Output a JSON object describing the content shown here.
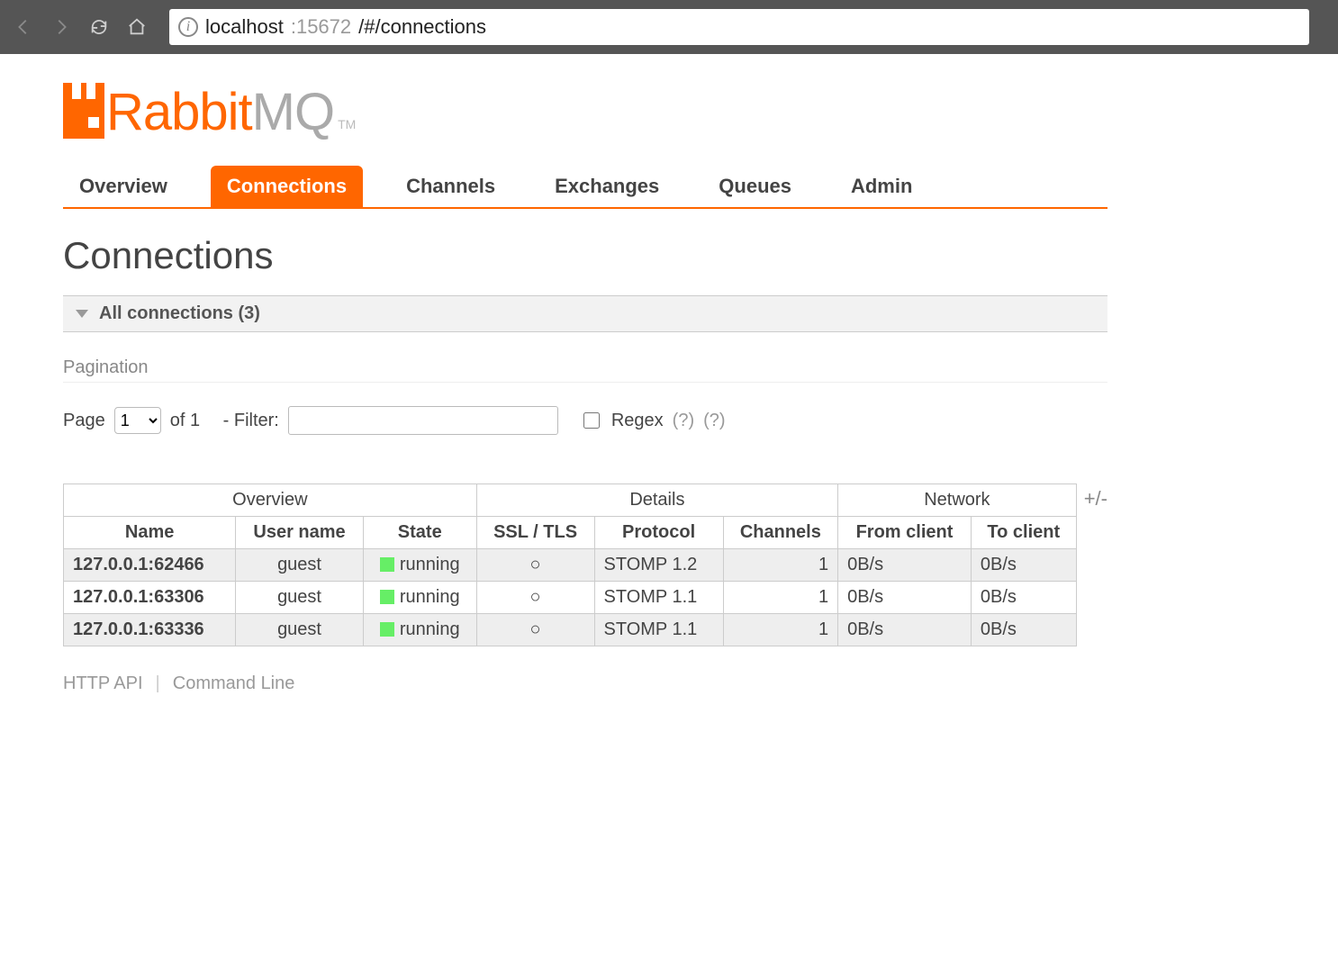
{
  "browser": {
    "url_host": "localhost",
    "url_port": ":15672",
    "url_path": "/#/connections"
  },
  "logo": {
    "part1": "Rabbit",
    "part2": "MQ",
    "tm": "TM"
  },
  "tabs": [
    {
      "label": "Overview",
      "active": false
    },
    {
      "label": "Connections",
      "active": true
    },
    {
      "label": "Channels",
      "active": false
    },
    {
      "label": "Exchanges",
      "active": false
    },
    {
      "label": "Queues",
      "active": false
    },
    {
      "label": "Admin",
      "active": false
    }
  ],
  "page_title": "Connections",
  "section": {
    "label": "All connections (3)"
  },
  "pagination": {
    "heading": "Pagination",
    "page_label": "Page",
    "page_value": "1",
    "of_text": "of 1",
    "filter_label": "- Filter:",
    "filter_value": "",
    "regex_label": "Regex",
    "help1": "(?)",
    "help2": "(?)"
  },
  "table": {
    "groups": [
      "Overview",
      "Details",
      "Network"
    ],
    "columns": [
      "Name",
      "User name",
      "State",
      "SSL / TLS",
      "Protocol",
      "Channels",
      "From client",
      "To client"
    ],
    "rows": [
      {
        "name": "127.0.0.1:62466",
        "user": "guest",
        "state": "running",
        "ssl": "○",
        "protocol": "STOMP 1.2",
        "channels": "1",
        "from": "0B/s",
        "to": "0B/s"
      },
      {
        "name": "127.0.0.1:63306",
        "user": "guest",
        "state": "running",
        "ssl": "○",
        "protocol": "STOMP 1.1",
        "channels": "1",
        "from": "0B/s",
        "to": "0B/s"
      },
      {
        "name": "127.0.0.1:63336",
        "user": "guest",
        "state": "running",
        "ssl": "○",
        "protocol": "STOMP 1.1",
        "channels": "1",
        "from": "0B/s",
        "to": "0B/s"
      }
    ],
    "plusminus": "+/-"
  },
  "footer": {
    "http_api": "HTTP API",
    "cli": "Command Line"
  }
}
